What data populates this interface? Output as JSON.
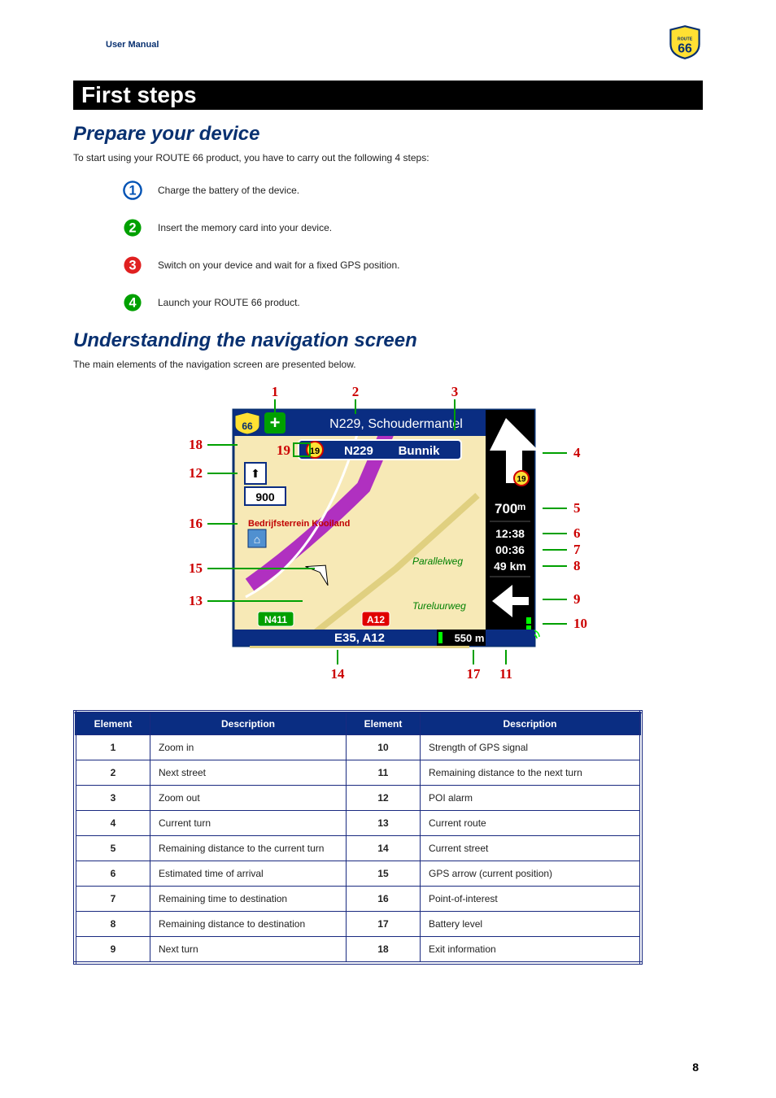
{
  "header": {
    "usermanual": "User Manual"
  },
  "section_title": "First steps",
  "prepare": {
    "heading": "Prepare your device",
    "intro": "To start using your ROUTE 66 product, you have to carry out the following 4 steps:",
    "steps": {
      "s1": "Charge the battery of the device.",
      "s2": "Insert the memory card into your device.",
      "s3": "Switch on your device and wait for a fixed GPS position.",
      "s4": "Launch your ROUTE 66 product."
    }
  },
  "understand": {
    "heading": "Understanding the navigation screen",
    "intro": "The main elements of the navigation screen are presented below."
  },
  "screenshot_text": {
    "street": "N229, Schoudermantel",
    "road": "N229",
    "city": "Bunnik",
    "dist_current_turn": "700ᵐ",
    "eta": "12:38",
    "rem_time": "00:36",
    "rem_dist": "49 km",
    "exit": "900",
    "poi": "Bedrijfsterrein Kooiland",
    "parallel": "Parallelweg",
    "ture": "Tureluurweg",
    "n411": "N411",
    "a12": "A12",
    "current_street": "E35, A12",
    "next_turn_dist": "550 m",
    "corner_num": "19",
    "sidebar_num": "19"
  },
  "callouts": {
    "c1": "1",
    "c2": "2",
    "c3": "3",
    "c4": "4",
    "c5": "5",
    "c6": "6",
    "c7": "7",
    "c8": "8",
    "c9": "9",
    "c10": "10",
    "c11": "11",
    "c12": "12",
    "c13": "13",
    "c14": "14",
    "c15": "15",
    "c16": "16",
    "c17": "17",
    "c18": "18",
    "c19": "19"
  },
  "table": {
    "headers": {
      "element": "Element",
      "description": "Description"
    },
    "rows": {
      "r1": {
        "a": "1",
        "ad": "Zoom in",
        "b": "10",
        "bd": "Strength of GPS signal"
      },
      "r2": {
        "a": "2",
        "ad": "Next street",
        "b": "11",
        "bd": "Remaining distance to the next turn"
      },
      "r3": {
        "a": "3",
        "ad": "Zoom out",
        "b": "12",
        "bd": "POI alarm"
      },
      "r4": {
        "a": "4",
        "ad": "Current turn",
        "b": "13",
        "bd": "Current route"
      },
      "r5": {
        "a": "5",
        "ad": "Remaining distance to the current turn",
        "b": "14",
        "bd": "Current street"
      },
      "r6": {
        "a": "6",
        "ad": "Estimated time of arrival",
        "b": "15",
        "bd": "GPS arrow (current position)"
      },
      "r7": {
        "a": "7",
        "ad": "Remaining time to destination",
        "b": "16",
        "bd": "Point-of-interest"
      },
      "r8": {
        "a": "8",
        "ad": "Remaining distance to destination",
        "b": "17",
        "bd": "Battery level"
      },
      "r9": {
        "a": "9",
        "ad": "Next turn",
        "b": "18",
        "bd": "Exit information"
      }
    }
  },
  "page_number": "8"
}
